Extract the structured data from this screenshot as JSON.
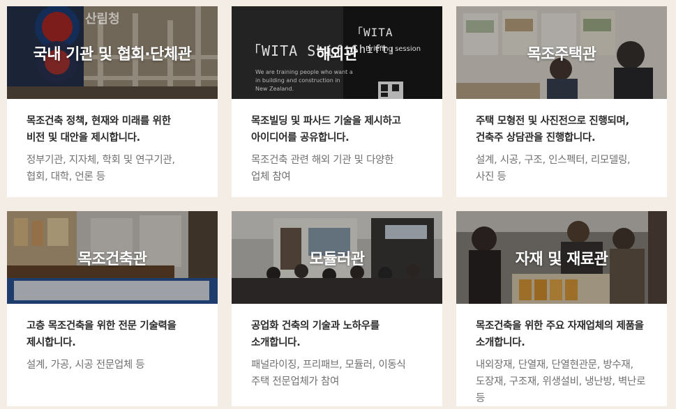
{
  "cards": [
    {
      "title": "국내 기관 및 협회·단체관",
      "desc_line1": "목조건축 정책, 현재와 미래를 위한",
      "desc_line2": "비전 및 대안을 제시합니다.",
      "detail_line1": "정부기관, 지자체, 학회 및 연구기관,",
      "detail_line2": "협회, 대학, 언론 등",
      "photo_sign": "산림청"
    },
    {
      "title": "해외관",
      "desc_line1": "목조빌딩 및 파사드 기술을 제시하고",
      "desc_line2": "아이디어를 공유합니다.",
      "detail_line1": "목조건축 관련 해외 기관 및 다양한",
      "detail_line2": "업체 참여",
      "photo_sign_left": "「WITA Shift",
      "photo_sign_right": "「WITA Shift」",
      "photo_sign_sub": "Briefing session",
      "photo_sign_body1": "We are training people who want a",
      "photo_sign_body2": "in building and construction in",
      "photo_sign_body3": "New Zealand."
    },
    {
      "title": "목조주택관",
      "desc_line1": "주택 모형전 및 사진전으로 진행되며,",
      "desc_line2": "건축주 상담관을 진행합니다.",
      "detail_line1": "설계, 시공, 구조, 인스펙터, 리모델링,",
      "detail_line2": "사진 등"
    },
    {
      "title": "목조건축관",
      "desc_line1": "고층 목조건축을 위한 전문 기술력을",
      "desc_line2": "제시합니다.",
      "detail_line1": "설계, 가공, 시공 전문업체 등",
      "detail_line2": ""
    },
    {
      "title": "모듈러관",
      "desc_line1": "공업화 건축의 기술과 노하우를",
      "desc_line2": "소개합니다.",
      "detail_line1": "패널라이징, 프리패브, 모듈러, 이동식",
      "detail_line2": "주택 전문업체가 참여"
    },
    {
      "title": "자재 및 재료관",
      "desc_line1": "목조건축을 위한 주요 자재업체의 제품을",
      "desc_line2": "소개합니다.",
      "detail_line1": "내외장재, 단열재, 단열현관문, 방수재,",
      "detail_line2": "도장재, 구조재, 위생설비, 냉난방, 벽난로",
      "detail_line3": "등"
    }
  ],
  "colors": {
    "page_bg": "#f3ede6",
    "card_bg": "#ffffff",
    "desc_text": "#2a2a2a",
    "detail_text": "#707070",
    "title_text": "#ffffff"
  }
}
